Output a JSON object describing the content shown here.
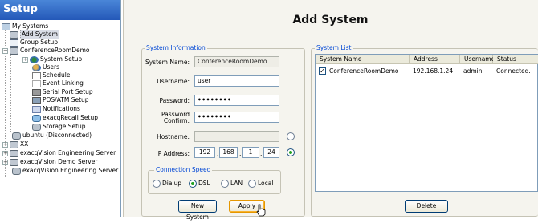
{
  "sidebar": {
    "title": "Setup",
    "items": [
      {
        "label": "My Systems"
      },
      {
        "label": "Add System"
      },
      {
        "label": "Group Setup"
      },
      {
        "label": "ConferenceRoomDemo"
      },
      {
        "label": "System Setup"
      },
      {
        "label": "Users"
      },
      {
        "label": "Schedule"
      },
      {
        "label": "Event Linking"
      },
      {
        "label": "Serial Port Setup"
      },
      {
        "label": "POS/ATM Setup"
      },
      {
        "label": "Notifications"
      },
      {
        "label": "exacqRecall Setup"
      },
      {
        "label": "Storage Setup"
      },
      {
        "label": "ubuntu (Disconnected)"
      },
      {
        "label": "XX"
      },
      {
        "label": "exacqVision Engineering Server"
      },
      {
        "label": "exacqVision Demo Server"
      },
      {
        "label": "exacqVision Engineering Server"
      }
    ]
  },
  "main": {
    "title": "Add System",
    "system_info": {
      "legend": "System Information",
      "system_name_label": "System Name:",
      "system_name_value": "ConferenceRoomDemo",
      "username_label": "Username:",
      "username_value": "user",
      "password_label": "Password:",
      "password_value": "••••••••",
      "password_confirm_label_1": "Password",
      "password_confirm_label_2": "Confirm:",
      "password_confirm_value": "••••••••",
      "hostname_label": "Hostname:",
      "hostname_value": "",
      "ip_label": "IP Address:",
      "ip_octets": [
        "192",
        "168",
        "1",
        "24"
      ],
      "ip_dot": ".",
      "speed_legend": "Connection Speed",
      "speed_options": [
        "Dialup",
        "DSL",
        "LAN",
        "Local"
      ],
      "speed_selected": "DSL",
      "address_mode_selected": "ip",
      "new_system_button": "New System",
      "apply_button": "Apply"
    },
    "system_list": {
      "legend": "System List",
      "columns": [
        "System Name",
        "Address",
        "Username",
        "Status"
      ],
      "rows": [
        {
          "checked": true,
          "name": "ConferenceRoomDemo",
          "address": "192.168.1.24",
          "username": "admin",
          "status": "Connected."
        }
      ],
      "delete_button": "Delete"
    }
  },
  "colors": {
    "header_blue": "#2458b8",
    "legend_blue": "#0046d5",
    "panel_bg": "#f5f4ee",
    "radio_selected": "#21a121"
  }
}
